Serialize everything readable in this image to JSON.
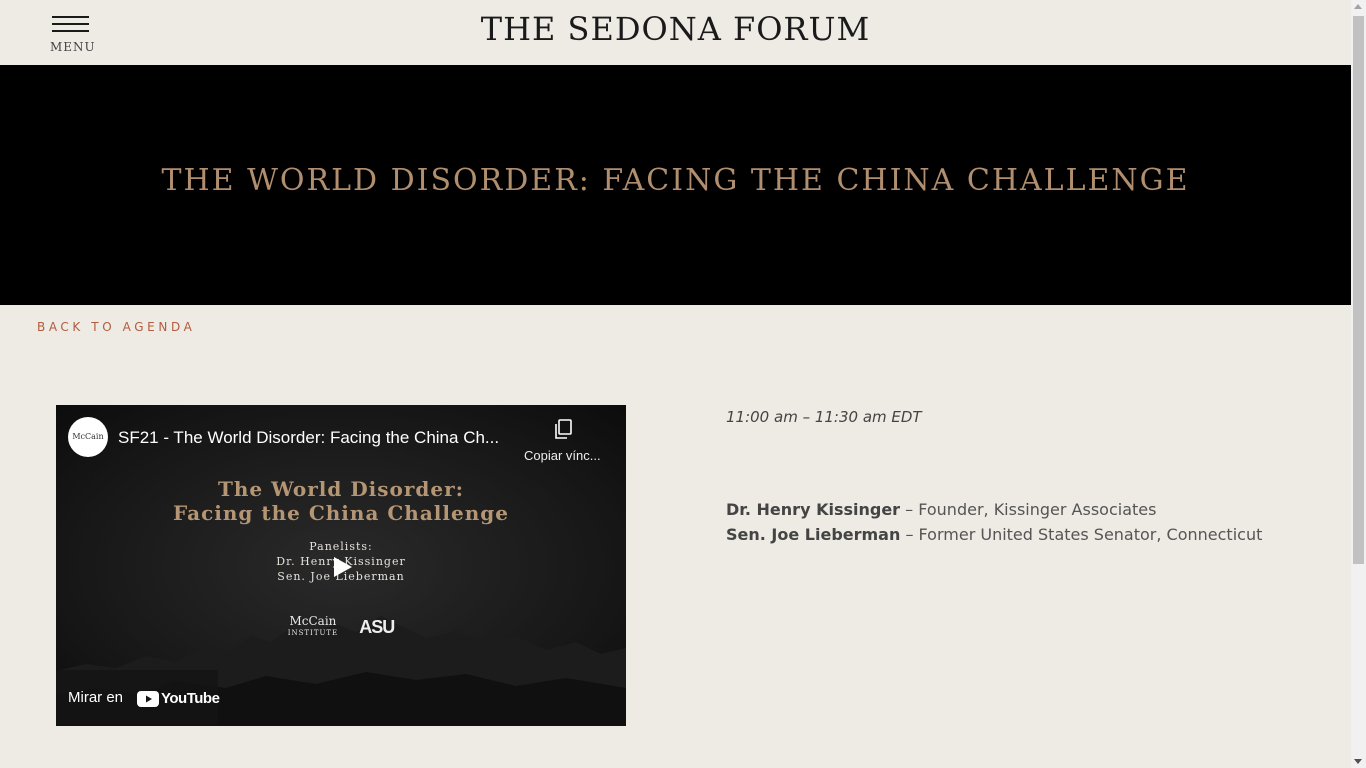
{
  "header": {
    "menu_label": "MENU",
    "site_title": "THE SEDONA FORUM"
  },
  "hero": {
    "title": "THE WORLD DISORDER: FACING THE CHINA CHALLENGE"
  },
  "back_link": "BACK TO AGENDA",
  "video": {
    "title": "SF21 - The World Disorder: Facing the China Ch...",
    "channel_logo_text": "McCain Institute",
    "copy_label": "Copiar vínc...",
    "thumbnail": {
      "title_line1": "The World Disorder:",
      "title_line2": "Facing the China Challenge",
      "panelists_heading": "Panelists:",
      "panelist_1": "Dr. Henry Kissinger",
      "panelist_2": "Sen. Joe Lieberman",
      "logo_1": "McCain",
      "logo_1_sub": "INSTITUTE",
      "logo_2": "ASU"
    },
    "watch_label": "Mirar en",
    "youtube_label": "YouTube"
  },
  "session": {
    "time": "11:00 am – 11:30 am EDT",
    "speakers": [
      {
        "name": "Dr. Henry Kissinger",
        "role": " – Founder, Kissinger Associates"
      },
      {
        "name": "Sen. Joe Lieberman",
        "role": " – Former United States Senator, Connecticut"
      }
    ]
  },
  "colors": {
    "background": "#eeeae4",
    "hero_bg": "#000000",
    "hero_title": "#b08e6e",
    "back_link": "#b45b3e",
    "youtube_red": "#ff0000"
  },
  "icons": [
    "hamburger-menu-icon",
    "copy-link-icon",
    "play-icon",
    "youtube-logo-icon"
  ]
}
